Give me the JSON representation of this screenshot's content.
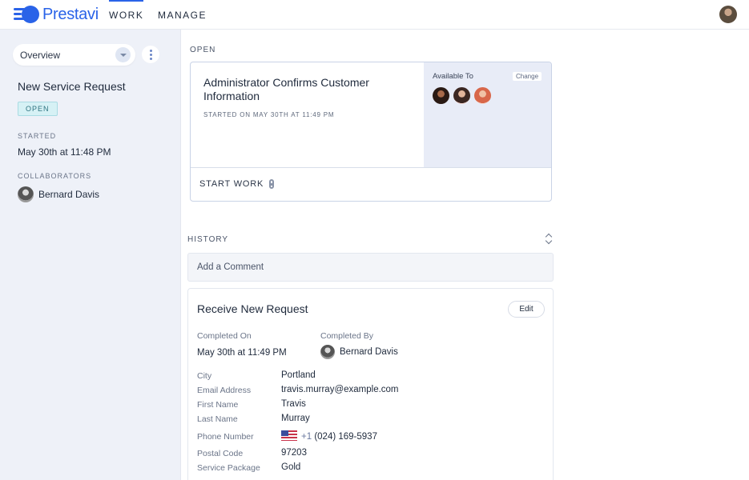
{
  "app": {
    "name": "Prestavi"
  },
  "nav": {
    "work": "WORK",
    "manage": "MANAGE"
  },
  "sidebar": {
    "select_value": "Overview",
    "title": "New Service Request",
    "status": "OPEN",
    "started_label": "STARTED",
    "started_value": "May 30th at 11:48 PM",
    "collaborators_label": "COLLABORATORS",
    "collaborator_name": "Bernard Davis"
  },
  "open_section": {
    "label": "OPEN",
    "task_title": "Administrator Confirms Customer Information",
    "started_text": "STARTED ON MAY 30TH AT 11:49 PM",
    "available_label": "Available To",
    "change_label": "Change",
    "start_work_label": "START WORK"
  },
  "history": {
    "label": "HISTORY",
    "comment_placeholder": "Add a Comment",
    "card_title": "Receive New Request",
    "edit_label": "Edit",
    "completed_on_label": "Completed On",
    "completed_on_value": "May 30th at 11:49 PM",
    "completed_by_label": "Completed By",
    "completed_by_value": "Bernard Davis",
    "fields": [
      {
        "label": "City",
        "value": "Portland"
      },
      {
        "label": "Email Address",
        "value": "travis.murray@example.com"
      },
      {
        "label": "First Name",
        "value": "Travis"
      },
      {
        "label": "Last Name",
        "value": "Murray"
      },
      {
        "label": "Phone Number",
        "value": "(024) 169-5937",
        "country_code": "+1"
      },
      {
        "label": "Postal Code",
        "value": "97203"
      },
      {
        "label": "Service Package",
        "value": "Gold"
      }
    ]
  },
  "colors": {
    "brand": "#2a63e8",
    "badge_bg": "#d6f1f5",
    "sidebar_bg": "#eef1f8",
    "assignee_bg": "#e8ecf7"
  }
}
